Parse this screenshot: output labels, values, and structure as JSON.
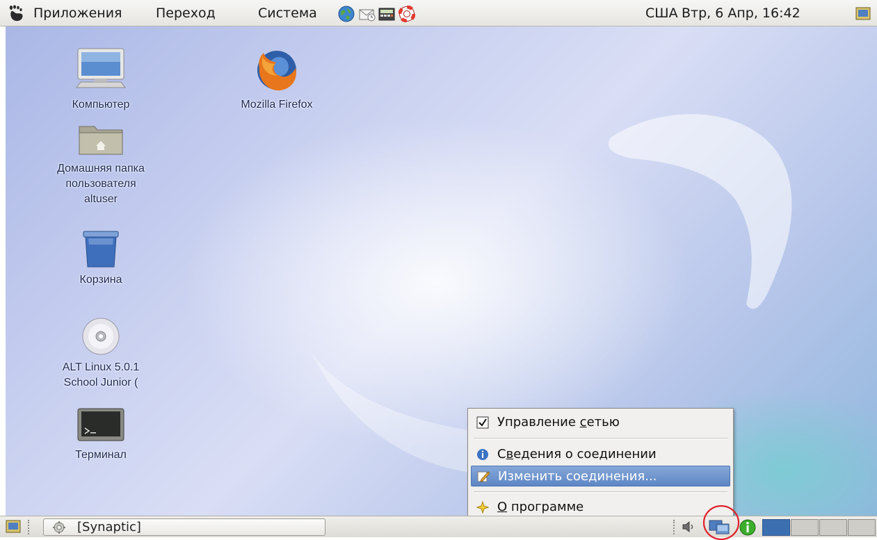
{
  "top_panel": {
    "menus": [
      "Приложения",
      "Переход",
      "Система"
    ],
    "keyboard_layout": "США",
    "clock": "Втр, 6 Апр, 16:42",
    "launchers": [
      "browser-icon",
      "mail-icon",
      "calculator-icon",
      "help-lifebuoy-icon"
    ]
  },
  "desktop": {
    "icons": [
      {
        "label": "Компьютер",
        "icon": "computer-icon"
      },
      {
        "label": "Mozilla Firefox",
        "icon": "firefox-icon"
      },
      {
        "label_lines": [
          "Домашняя папка",
          "пользователя",
          "altuser"
        ],
        "icon": "home-folder-icon"
      },
      {
        "label": "Корзина",
        "icon": "trash-icon"
      },
      {
        "label_lines": [
          "ALT Linux 5.0.1",
          "School Junior  ("
        ],
        "icon": "cdrom-icon"
      },
      {
        "label": "Терминал",
        "icon": "terminal-icon"
      }
    ]
  },
  "menu": {
    "items": [
      {
        "label": "Управление сетью",
        "underline_char": "с",
        "icon": "checkbox-checked-icon",
        "checked": true
      },
      {
        "label": "Сведения о соединении",
        "underline_char": "в",
        "icon": "info-icon"
      },
      {
        "label": "Изменить соединения...",
        "icon": "edit-icon",
        "highlighted": true
      },
      {
        "label": "О программе",
        "underline_char": "О",
        "icon": "star-icon"
      }
    ]
  },
  "bottom_panel": {
    "taskbar": [
      {
        "label": "[Synaptic]",
        "icon": "synaptic-icon"
      }
    ],
    "tray": [
      "volume-icon",
      "network-monitor-icon",
      "info-icon"
    ],
    "workspaces": 4,
    "active_workspace": 1
  },
  "colors": {
    "menu_highlight": "#5d86c5",
    "active_workspace": "#3c6fb0",
    "annotation_circle": "#e0202a"
  }
}
